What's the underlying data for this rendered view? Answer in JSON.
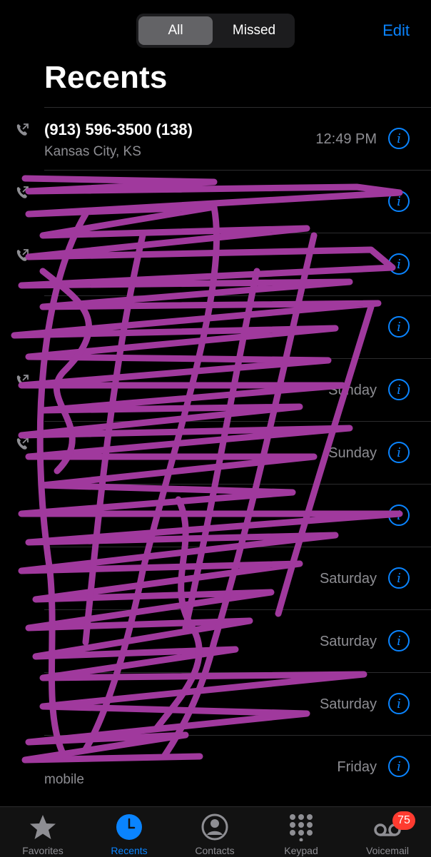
{
  "header": {
    "segments": [
      "All",
      "Missed"
    ],
    "edit_label": "Edit",
    "title": "Recents"
  },
  "calls": [
    {
      "name": "(913) 596-3500 (138)",
      "subtitle": "Kansas City, KS",
      "time": "12:49 PM",
      "outgoing": true
    },
    {
      "name": "",
      "subtitle": "",
      "time": "",
      "outgoing": true
    },
    {
      "name": "",
      "subtitle": "",
      "time": "",
      "outgoing": true
    },
    {
      "name": "",
      "subtitle": "",
      "time": "",
      "outgoing": false
    },
    {
      "name": "",
      "subtitle": "",
      "time": "Sunday",
      "outgoing": true
    },
    {
      "name": "",
      "subtitle": "",
      "time": "Sunday",
      "outgoing": true
    },
    {
      "name": "",
      "subtitle": "",
      "time": "",
      "outgoing": false
    },
    {
      "name": "",
      "subtitle": "",
      "time": "Saturday",
      "outgoing": false
    },
    {
      "name": "",
      "subtitle": "",
      "time": "Saturday",
      "outgoing": false
    },
    {
      "name": "",
      "subtitle": "",
      "time": "Saturday",
      "outgoing": false
    },
    {
      "name": "",
      "subtitle": "mobile",
      "time": "Friday",
      "outgoing": false
    }
  ],
  "tabs": [
    {
      "label": "Favorites",
      "icon": "star-icon"
    },
    {
      "label": "Recents",
      "icon": "clock-icon",
      "active": true
    },
    {
      "label": "Contacts",
      "icon": "person-icon"
    },
    {
      "label": "Keypad",
      "icon": "keypad-icon"
    },
    {
      "label": "Voicemail",
      "icon": "voicemail-icon",
      "badge": "75"
    }
  ],
  "colors": {
    "accent": "#0a84ff",
    "background": "#000000",
    "secondary_text": "#8e8e93",
    "badge": "#ff3b30",
    "redaction": "#a0399d"
  }
}
